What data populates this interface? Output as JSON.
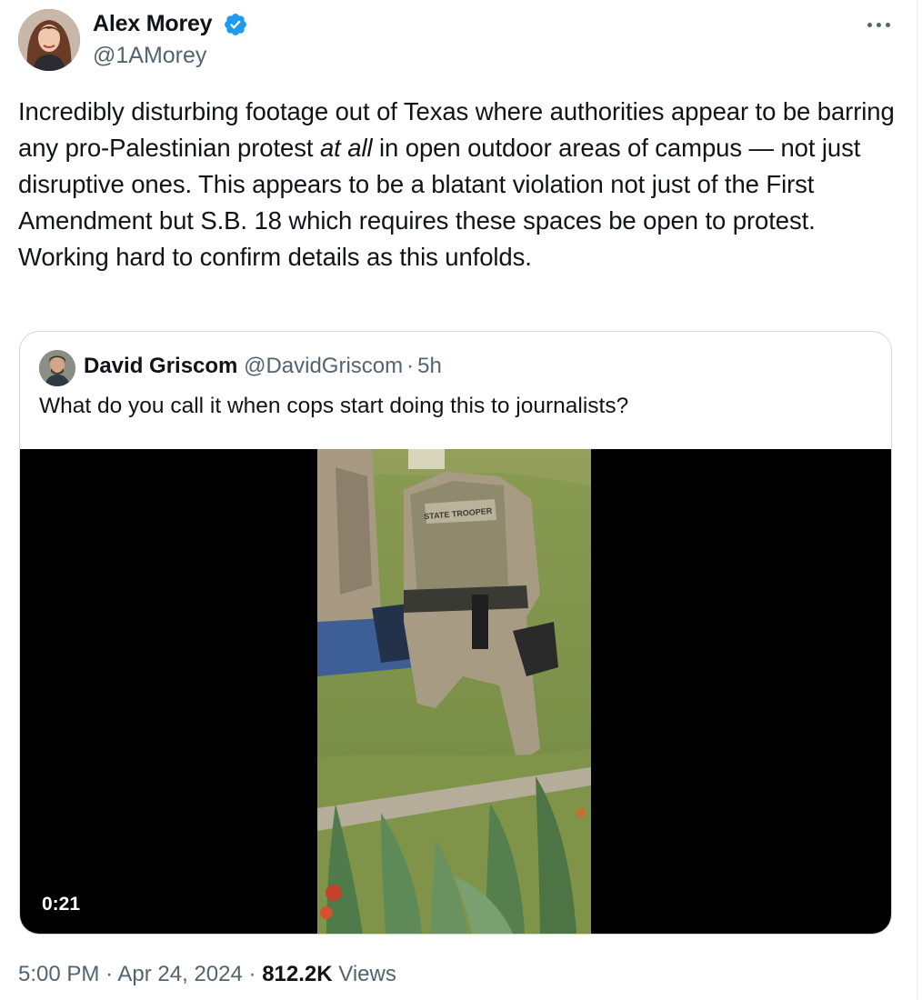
{
  "tweet": {
    "author": {
      "name": "Alex Morey",
      "handle": "@1AMorey",
      "avatar_icon": "profile-photo",
      "verified": true,
      "verified_color": "#1d9bf0"
    },
    "more_icon": "more-horizontal-icon",
    "text_parts": {
      "before": "Incredibly disturbing footage out of Texas where authorities appear to be barring any pro-Palestinian protest ",
      "emphasis": "at all",
      "after": " in open outdoor areas of campus — not just disruptive ones. This appears to be a blatant violation not just of the First Amendment but S.B. 18 which requires these spaces be open to protest. Working hard to confirm details as this unfolds."
    },
    "quoted": {
      "name": "David Griscom",
      "handle": "@DavidGriscom",
      "separator": "·",
      "time": "5h",
      "text": "What do you call it when cops start doing this to journalists?",
      "video": {
        "duration": "0:21",
        "vest_text": "STATE TROOPER"
      }
    },
    "meta": {
      "time": "5:00 PM",
      "sep1": "·",
      "date": "Apr 24, 2024",
      "sep2": "·",
      "views_count": "812.2K",
      "views_label": "Views"
    },
    "colors": {
      "text": "#0f1419",
      "secondary": "#536471",
      "border": "#cfd9de"
    }
  }
}
